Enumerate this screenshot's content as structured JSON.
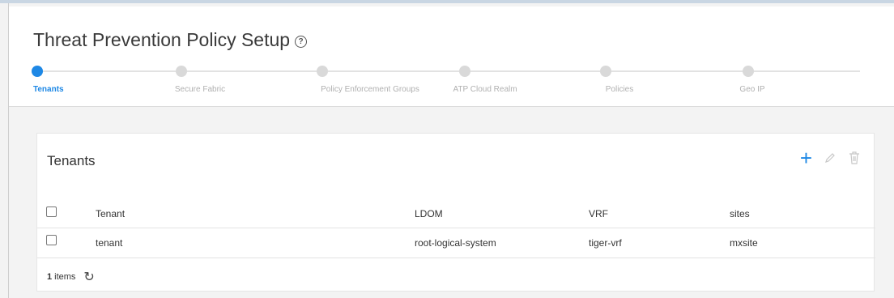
{
  "page": {
    "title": "Threat Prevention Policy Setup",
    "help_icon": "help-circle-icon"
  },
  "stepper": {
    "steps": [
      {
        "label": "Tenants",
        "active": true
      },
      {
        "label": "Secure Fabric",
        "active": false
      },
      {
        "label": "Policy Enforcement Groups",
        "active": false
      },
      {
        "label": "ATP Cloud Realm",
        "active": false
      },
      {
        "label": "Policies",
        "active": false
      },
      {
        "label": "Geo IP",
        "active": false
      }
    ],
    "accent_color": "#1e88e5"
  },
  "card": {
    "title": "Tenants",
    "tools": {
      "add_icon": "plus-icon",
      "edit_icon": "pencil-icon",
      "delete_icon": "trash-icon"
    }
  },
  "table": {
    "columns": [
      "Tenant",
      "LDOM",
      "VRF",
      "sites"
    ],
    "rows": [
      {
        "tenant": "tenant",
        "ldom": "root-logical-system",
        "vrf": "tiger-vrf",
        "sites": "mxsite"
      }
    ]
  },
  "footer": {
    "count": "1",
    "count_label": "items",
    "refresh_icon": "refresh-icon"
  }
}
